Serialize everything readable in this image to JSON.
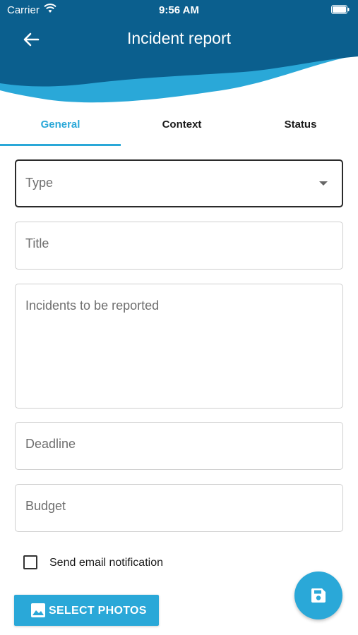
{
  "status_bar": {
    "carrier": "Carrier",
    "time": "9:56 AM"
  },
  "header": {
    "title": "Incident report",
    "back_icon": "arrow-left-icon"
  },
  "tabs": [
    {
      "label": "General",
      "active": true
    },
    {
      "label": "Context",
      "active": false
    },
    {
      "label": "Status",
      "active": false
    }
  ],
  "form": {
    "type": {
      "placeholder": "Type",
      "value": ""
    },
    "title": {
      "placeholder": "Title",
      "value": ""
    },
    "incidents": {
      "placeholder": "Incidents to be reported",
      "value": ""
    },
    "deadline": {
      "placeholder": "Deadline",
      "value": ""
    },
    "budget": {
      "placeholder": "Budget",
      "value": ""
    },
    "email_notification": {
      "label": "Send email notification",
      "checked": false
    }
  },
  "actions": {
    "select_photos": "SELECT PHOTOS",
    "photos_icon": "image-icon",
    "save_icon": "save-icon"
  },
  "colors": {
    "header_dark": "#0b5f8e",
    "header_light": "#2aa8d8",
    "accent": "#2aa8d8"
  }
}
